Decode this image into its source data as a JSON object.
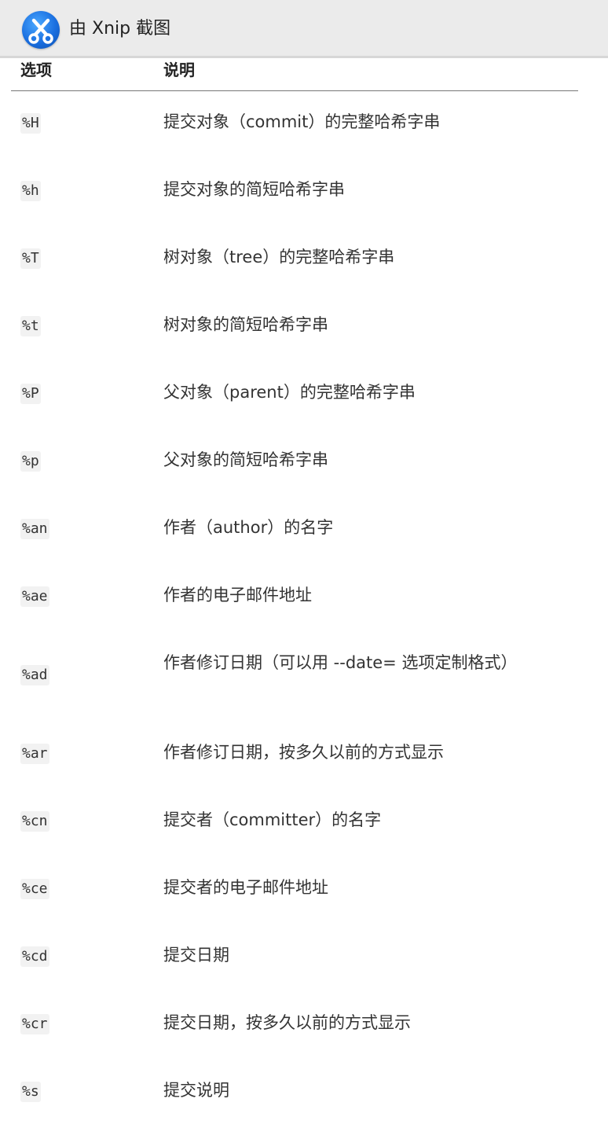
{
  "window": {
    "title": "由 Xnip 截图",
    "logo_icon": "xnip-scissors-icon",
    "accent": "#1a6fe0"
  },
  "table": {
    "headers": [
      "选项",
      "说明"
    ],
    "rows": [
      {
        "option": "%H",
        "description": "提交对象（commit）的完整哈希字串"
      },
      {
        "option": "%h",
        "description": "提交对象的简短哈希字串"
      },
      {
        "option": "%T",
        "description": "树对象（tree）的完整哈希字串"
      },
      {
        "option": "%t",
        "description": "树对象的简短哈希字串"
      },
      {
        "option": "%P",
        "description": "父对象（parent）的完整哈希字串"
      },
      {
        "option": "%p",
        "description": "父对象的简短哈希字串"
      },
      {
        "option": "%an",
        "description": "作者（author）的名字"
      },
      {
        "option": "%ae",
        "description": "作者的电子邮件地址"
      },
      {
        "option": "%ad",
        "description": "作者修订日期（可以用 --date= 选项定制格式）"
      },
      {
        "option": "%ar",
        "description": "作者修订日期，按多久以前的方式显示"
      },
      {
        "option": "%cn",
        "description": "提交者（committer）的名字"
      },
      {
        "option": "%ce",
        "description": "提交者的电子邮件地址"
      },
      {
        "option": "%cd",
        "description": "提交日期"
      },
      {
        "option": "%cr",
        "description": "提交日期，按多久以前的方式显示"
      },
      {
        "option": "%s",
        "description": "提交说明"
      }
    ]
  }
}
